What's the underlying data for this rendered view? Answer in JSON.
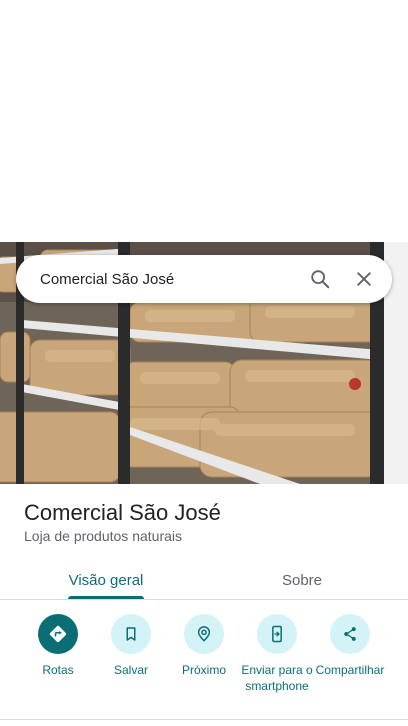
{
  "search": {
    "query": "Comercial São José"
  },
  "place": {
    "name": "Comercial São José",
    "category": "Loja de produtos naturais"
  },
  "tabs": [
    {
      "label": "Visão geral",
      "active": true
    },
    {
      "label": "Sobre",
      "active": false
    }
  ],
  "actions": [
    {
      "label": "Rotas",
      "icon": "directions-icon"
    },
    {
      "label": "Salvar",
      "icon": "bookmark-icon"
    },
    {
      "label": "Próximo",
      "icon": "nearby-icon"
    },
    {
      "label": "Enviar para o smartphone",
      "icon": "send-to-phone-icon"
    },
    {
      "label": "Compartilhar",
      "icon": "share-icon"
    }
  ],
  "colors": {
    "accent": "#0b6e75",
    "action_bg": "#d4f3f6"
  }
}
